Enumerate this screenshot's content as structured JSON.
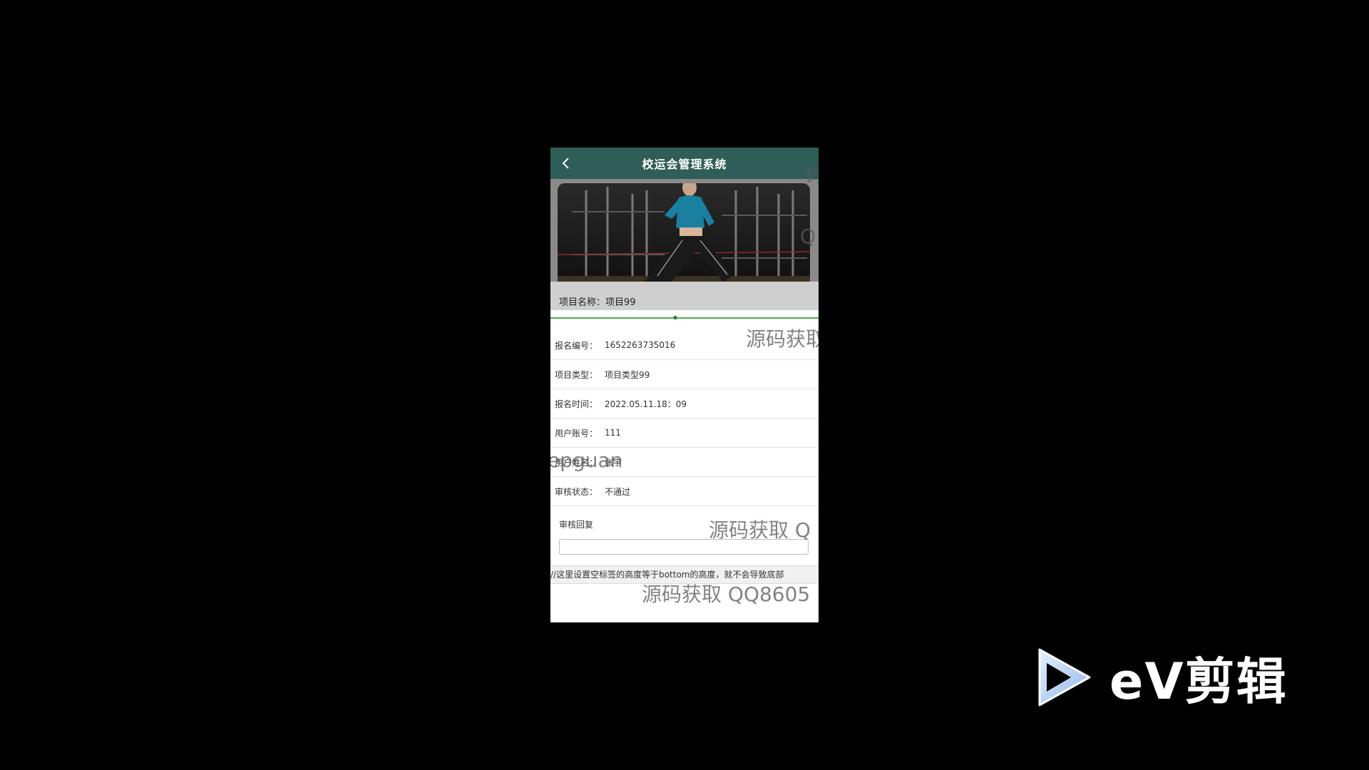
{
  "app": {
    "title": "校运会管理系统"
  },
  "project": {
    "name_label": "项目名称：",
    "name_value": "项目99"
  },
  "fields": [
    {
      "label": "报名编号：",
      "value": "1652263735016"
    },
    {
      "label": "项目类型：",
      "value": "项目类型99"
    },
    {
      "label": "报名时间：",
      "value": "2022.05.11.18：09"
    },
    {
      "label": "用户账号：",
      "value": "111"
    },
    {
      "label": "用户姓名：",
      "value": "张宇"
    },
    {
      "label": "审核状态：",
      "value": "不通过"
    }
  ],
  "reply": {
    "label": "审核回复",
    "value": ""
  },
  "comment_text": "//这里设置空标签的高度等于bottom的高度，就不会导致底部",
  "watermarks": [
    "码",
    "Q",
    "源码获取",
    "epguan",
    "源码获取 Q",
    "源码获取 QQ8605"
  ],
  "branding": {
    "logo_text": "eV剪辑"
  }
}
